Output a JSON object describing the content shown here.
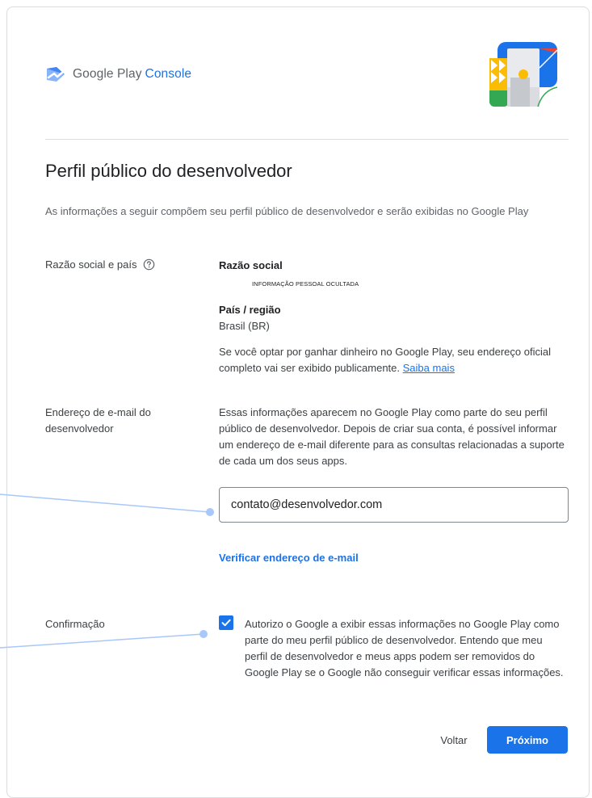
{
  "header": {
    "brand_google_play": "Google Play",
    "brand_console": "Console"
  },
  "page": {
    "title": "Perfil público do desenvolvedor",
    "intro": "As informações a seguir compõem seu perfil público de desenvolvedor e serão exibidas no Google Play"
  },
  "legal_section": {
    "label": "Razão social e país",
    "company_name_heading": "Razão social",
    "company_name_value": "INFORMAÇÃO PESSOAL OCULTADA",
    "country_heading": "País / região",
    "country_value": "Brasil (BR)",
    "address_notice": "Se você optar por ganhar dinheiro no Google Play, seu endereço oficial completo vai ser exibido publicamente.",
    "learn_more_link": "Saiba mais"
  },
  "email_section": {
    "label": "Endereço de e-mail do desenvolvedor",
    "description": "Essas informações aparecem no Google Play como parte do seu perfil público de desenvolvedor. Depois de criar sua conta, é possível informar um endereço de e-mail diferente para as consultas relacionadas a suporte de cada um dos seus apps.",
    "email_value": "contato@desenvolvedor.com",
    "verify_link": "Verificar endereço de e-mail"
  },
  "confirmation_section": {
    "label": "Confirmação",
    "checked": true,
    "text": "Autorizo o Google a exibir essas informações no Google Play como parte do meu perfil público de desenvolvedor. Entendo que meu perfil de desenvolvedor e meus apps podem ser removidos do Google Play se o Google não conseguir verificar essas informações."
  },
  "footer": {
    "back_label": "Voltar",
    "next_label": "Próximo"
  },
  "colors": {
    "accent": "#1a73e8",
    "callout_line": "#a8c7fa"
  },
  "icons": [
    "play-console-logo-icon",
    "help-circle-icon",
    "checkmark-icon",
    "header-illustration"
  ]
}
